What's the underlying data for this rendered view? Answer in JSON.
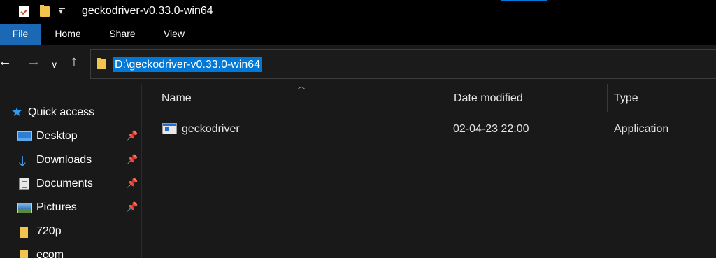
{
  "window": {
    "title": "geckodriver-v0.33.0-win64"
  },
  "ribbon": {
    "tabs": [
      "File",
      "Home",
      "Share",
      "View"
    ]
  },
  "address": {
    "path": "D:\\geckodriver-v0.33.0-win64"
  },
  "nav_pane": {
    "items": [
      {
        "label": "Quick access",
        "icon": "star-icon",
        "pinned": false
      },
      {
        "label": "Desktop",
        "icon": "desktop-icon",
        "pinned": true
      },
      {
        "label": "Downloads",
        "icon": "download-icon",
        "pinned": true
      },
      {
        "label": "Documents",
        "icon": "documents-icon",
        "pinned": true
      },
      {
        "label": "Pictures",
        "icon": "pictures-icon",
        "pinned": true
      },
      {
        "label": "720p",
        "icon": "folder-icon",
        "pinned": false
      },
      {
        "label": "ecom",
        "icon": "folder-icon",
        "pinned": false
      }
    ]
  },
  "columns": {
    "name": "Name",
    "date": "Date modified",
    "type": "Type"
  },
  "files": [
    {
      "name": "geckodriver",
      "date": "02-04-23 22:00",
      "type": "Application",
      "icon": "application-icon"
    }
  ],
  "colors": {
    "background": "#191919",
    "accent": "#0078d7",
    "file_tab": "#1b69b4"
  }
}
